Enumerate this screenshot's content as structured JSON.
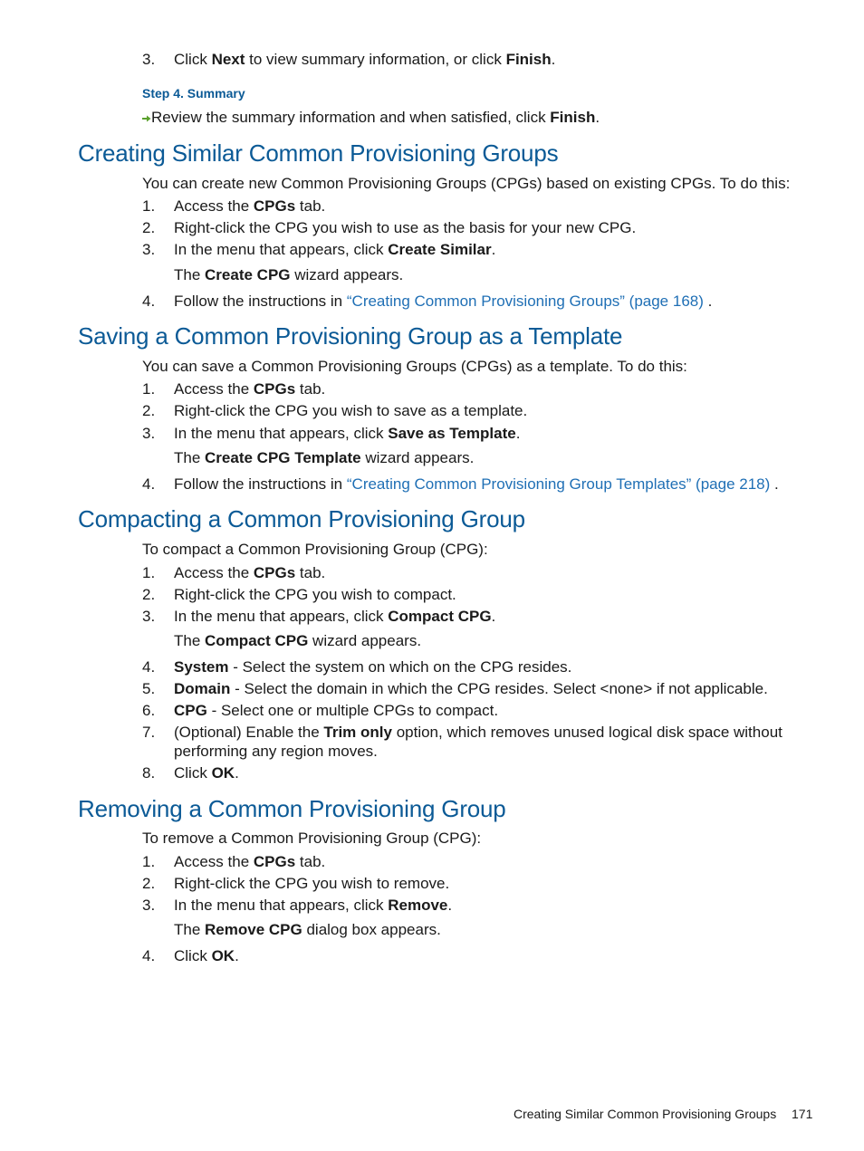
{
  "top": {
    "step3": {
      "num": "3.",
      "pre": "Click ",
      "b1": "Next",
      "mid": " to view summary information, or click ",
      "b2": "Finish",
      "post": "."
    },
    "step4_heading": "Step 4. Summary",
    "step4_text": {
      "pre": "Review the summary information and when satisfied, click ",
      "b": "Finish",
      "post": "."
    }
  },
  "sections": {
    "similar": {
      "title": "Creating Similar Common Provisioning Groups",
      "intro": "You can create new Common Provisioning Groups (CPGs) based on existing CPGs. To do this:",
      "s1": {
        "num": "1.",
        "pre": "Access the ",
        "b": "CPGs",
        "post": " tab."
      },
      "s2": {
        "num": "2.",
        "text": "Right-click the CPG you wish to use as the basis for your new CPG."
      },
      "s3": {
        "num": "3.",
        "pre": "In the menu that appears, click ",
        "b": "Create Similar",
        "post": "."
      },
      "s3_result": {
        "pre": "The ",
        "b": "Create CPG",
        "post": " wizard appears."
      },
      "s4": {
        "num": "4.",
        "pre": "Follow the instructions in ",
        "link": "“Creating Common Provisioning Groups” (page 168)",
        "post": " ."
      }
    },
    "template": {
      "title": "Saving a Common Provisioning Group as a Template",
      "intro": "You can save a Common Provisioning Groups (CPGs) as a template. To do this:",
      "s1": {
        "num": "1.",
        "pre": "Access the ",
        "b": "CPGs",
        "post": " tab."
      },
      "s2": {
        "num": "2.",
        "text": "Right-click the CPG you wish to save as a template."
      },
      "s3": {
        "num": "3.",
        "pre": "In the menu that appears, click ",
        "b": "Save as Template",
        "post": "."
      },
      "s3_result": {
        "pre": "The ",
        "b": "Create CPG Template",
        "post": " wizard appears."
      },
      "s4": {
        "num": "4.",
        "pre": "Follow the instructions in ",
        "link": "“Creating Common Provisioning Group Templates” (page 218)",
        "post": " ."
      }
    },
    "compact": {
      "title": "Compacting a Common Provisioning Group",
      "intro": "To compact a Common Provisioning Group (CPG):",
      "s1": {
        "num": "1.",
        "pre": "Access the ",
        "b": "CPGs",
        "post": " tab."
      },
      "s2": {
        "num": "2.",
        "text": "Right-click the CPG you wish to compact."
      },
      "s3": {
        "num": "3.",
        "pre": "In the menu that appears, click ",
        "b": "Compact CPG",
        "post": "."
      },
      "s3_result": {
        "pre": "The ",
        "b": "Compact CPG",
        "post": " wizard appears."
      },
      "s4": {
        "num": "4.",
        "b": "System",
        "post": " - Select the system on which on the CPG resides."
      },
      "s5": {
        "num": "5.",
        "b": "Domain",
        "post": " - Select the domain in which the CPG resides. Select <none> if not applicable."
      },
      "s6": {
        "num": "6.",
        "b": "CPG",
        "post": " - Select one or multiple CPGs to compact."
      },
      "s7": {
        "num": "7.",
        "pre": "(Optional) Enable the ",
        "b": "Trim only",
        "post": " option, which removes unused logical disk space without",
        "cont": "performing any region moves."
      },
      "s8": {
        "num": "8.",
        "pre": "Click ",
        "b": "OK",
        "post": "."
      }
    },
    "remove": {
      "title": "Removing a Common Provisioning Group",
      "intro": "To remove a Common Provisioning Group (CPG):",
      "s1": {
        "num": "1.",
        "pre": "Access the ",
        "b": "CPGs",
        "post": " tab."
      },
      "s2": {
        "num": "2.",
        "text": "Right-click the CPG you wish to remove."
      },
      "s3": {
        "num": "3.",
        "pre": "In the menu that appears, click ",
        "b": "Remove",
        "post": "."
      },
      "s3_result": {
        "pre": "The ",
        "b": "Remove CPG",
        "post": " dialog box appears."
      },
      "s4": {
        "num": "4.",
        "pre": "Click ",
        "b": "OK",
        "post": "."
      }
    }
  },
  "footer": {
    "section": "Creating Similar Common Provisioning Groups",
    "page": "171"
  },
  "icons": {
    "step_arrow": "green-arrow-right-icon"
  },
  "colors": {
    "heading": "#0b5a96",
    "link": "#1f6fb5",
    "arrow": "#5aa02c"
  }
}
